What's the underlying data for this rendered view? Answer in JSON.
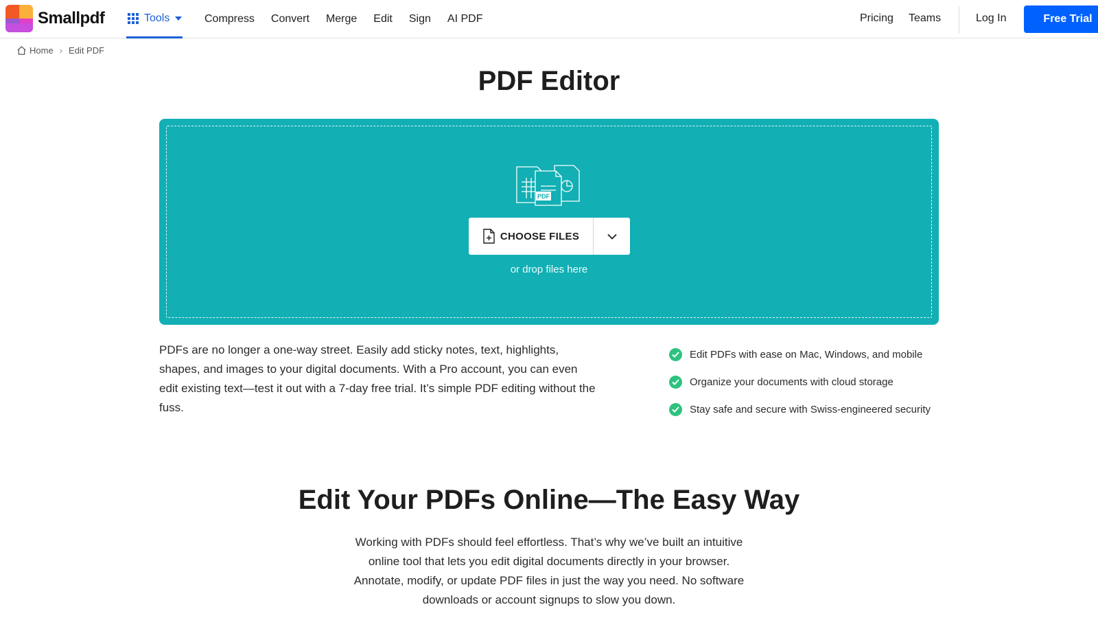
{
  "brand": {
    "name": "Smallpdf"
  },
  "nav": {
    "tools_label": "Tools",
    "links": [
      "Compress",
      "Convert",
      "Merge",
      "Edit",
      "Sign",
      "AI PDF"
    ],
    "pricing": "Pricing",
    "teams": "Teams",
    "login": "Log In",
    "free_trial": "Free Trial"
  },
  "breadcrumb": {
    "home": "Home",
    "current": "Edit PDF"
  },
  "page_title": "PDF Editor",
  "dropzone": {
    "choose_files": "CHOOSE FILES",
    "drop_hint": "or drop files here",
    "illustration_badge": "PDF",
    "bg_color": "#12afb4"
  },
  "description": "PDFs are no longer a one-way street. Easily add sticky notes, text, highlights, shapes, and images to your digital documents. With a Pro account, you can even edit existing text—test it out with a 7-day free trial. It’s simple PDF editing without the fuss.",
  "features": [
    "Edit PDFs with ease on Mac, Windows, and mobile",
    "Organize your documents with cloud storage",
    "Stay safe and secure with Swiss-engineered security"
  ],
  "section": {
    "heading": "Edit Your PDFs Online—The Easy Way",
    "intro": "Working with PDFs should feel effortless. That’s why we’ve built an intuitive online tool that lets you edit digital documents directly in your browser. Annotate, modify, or update PDF files in just the way you need. No software downloads or account signups to slow you down."
  },
  "colors": {
    "accent": "#0061fe",
    "check": "#2ec27e",
    "tools": "#1c5fd6"
  }
}
